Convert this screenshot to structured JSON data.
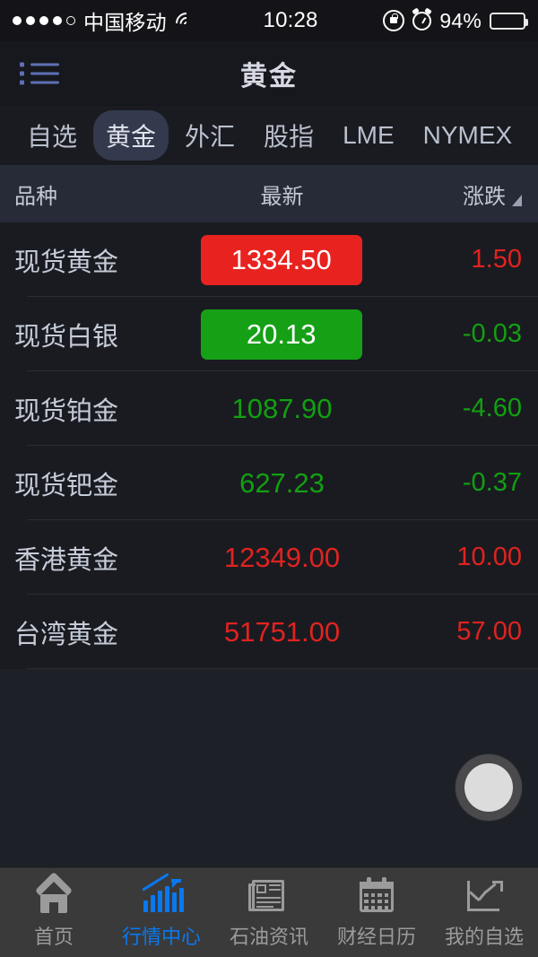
{
  "status_bar": {
    "signal_dots_filled": 4,
    "signal_dots_total": 5,
    "carrier": "中国移动",
    "wifi_icon": "wifi-icon",
    "time": "10:28",
    "rotation_lock_icon": "rotation-lock-icon",
    "alarm_icon": "alarm-clock-icon",
    "battery_percent": "94%",
    "battery_icon": "battery-icon"
  },
  "nav": {
    "menu_icon": "list-menu-icon",
    "title": "黄金"
  },
  "category_tabs": [
    {
      "label": "自选",
      "active": false
    },
    {
      "label": "黄金",
      "active": true
    },
    {
      "label": "外汇",
      "active": false
    },
    {
      "label": "股指",
      "active": false
    },
    {
      "label": "LME",
      "active": false
    },
    {
      "label": "NYMEX",
      "active": false
    }
  ],
  "table": {
    "headers": {
      "name": "品种",
      "last": "最新",
      "change": "涨跌"
    },
    "sort_indicator": "sort-triangle-icon",
    "rows": [
      {
        "name": "现货黄金",
        "last": "1334.50",
        "change": "1.50",
        "direction": "up",
        "highlight": "up"
      },
      {
        "name": "现货白银",
        "last": "20.13",
        "change": "-0.03",
        "direction": "down",
        "highlight": "down"
      },
      {
        "name": "现货铂金",
        "last": "1087.90",
        "change": "-4.60",
        "direction": "down",
        "highlight": "none"
      },
      {
        "name": "现货钯金",
        "last": "627.23",
        "change": "-0.37",
        "direction": "down",
        "highlight": "none"
      },
      {
        "name": "香港黄金",
        "last": "12349.00",
        "change": "10.00",
        "direction": "up",
        "highlight": "none"
      },
      {
        "name": "台湾黄金",
        "last": "51751.00",
        "change": "57.00",
        "direction": "up",
        "highlight": "none"
      }
    ]
  },
  "floating_button": {
    "icon": "assistive-touch-button"
  },
  "bottom_tabs": [
    {
      "label": "首页",
      "icon": "home-icon",
      "active": false
    },
    {
      "label": "行情中心",
      "icon": "bar-chart-up-icon",
      "active": true
    },
    {
      "label": "石油资讯",
      "icon": "newspaper-icon",
      "active": false
    },
    {
      "label": "财经日历",
      "icon": "calendar-icon",
      "active": false
    },
    {
      "label": "我的自选",
      "icon": "line-chart-up-icon",
      "active": false
    }
  ],
  "colors": {
    "up": "#e0231f",
    "down": "#11a011",
    "accent": "#0a78f0",
    "badge_up_bg": "#e8231f",
    "badge_down_bg": "#16a016",
    "tab_active_pill": "#343a4d"
  }
}
